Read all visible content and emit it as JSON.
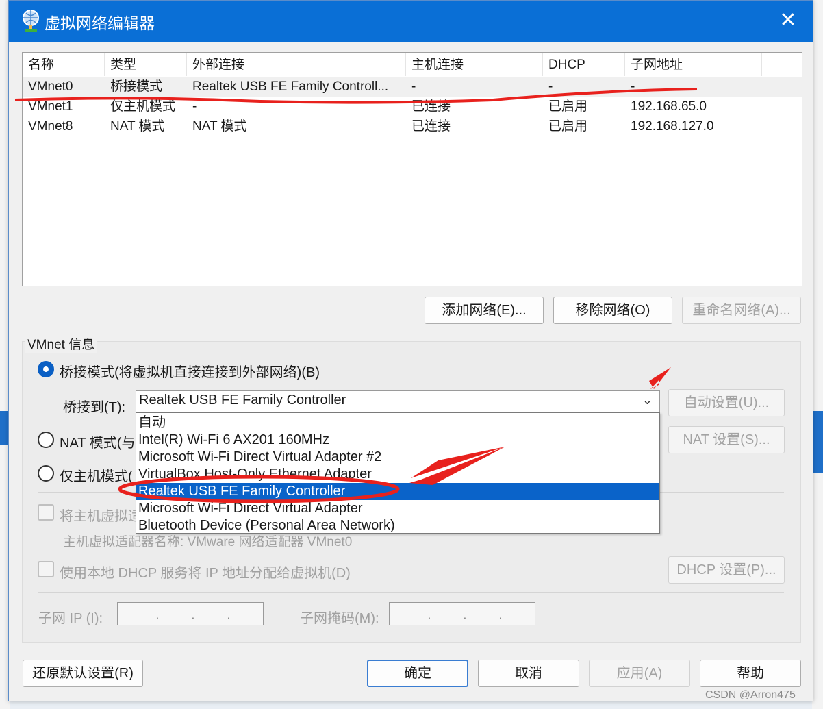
{
  "window": {
    "title": "虚拟网络编辑器",
    "close_glyph": "✕"
  },
  "list": {
    "columns": [
      "名称",
      "类型",
      "外部连接",
      "主机连接",
      "DHCP",
      "子网地址"
    ],
    "rows": [
      [
        "VMnet0",
        "桥接模式",
        "Realtek USB FE Family Controll...",
        "-",
        "-",
        "-"
      ],
      [
        "VMnet1",
        "仅主机模式",
        "-",
        "已连接",
        "已启用",
        "192.168.65.0"
      ],
      [
        "VMnet8",
        "NAT 模式",
        "NAT 模式",
        "已连接",
        "已启用",
        "192.168.127.0"
      ]
    ],
    "selected_row": 0
  },
  "list_buttons": {
    "add": "添加网络(E)...",
    "remove": "移除网络(O)",
    "rename": "重命名网络(A)..."
  },
  "vmnet_info": {
    "group_label": "VMnet 信息",
    "bridged_radio": "桥接模式(将虚拟机直接连接到外部网络)(B)",
    "bridge_to_label": "桥接到(T):",
    "bridge_to_value": "Realtek USB FE Family Controller",
    "bridge_options": [
      "自动",
      "Intel(R) Wi-Fi 6 AX201 160MHz",
      "Microsoft Wi-Fi Direct Virtual Adapter #2",
      "VirtualBox Host-Only Ethernet Adapter",
      "Realtek USB FE Family Controller",
      "Microsoft Wi-Fi Direct Virtual Adapter",
      "Bluetooth Device (Personal Area Network)"
    ],
    "highlighted_option": 4,
    "auto_settings": "自动设置(U)...",
    "nat_radio": "NAT 模式(与",
    "nat_settings": "NAT 设置(S)...",
    "hostonly_radio": "仅主机模式(",
    "host_adapter_check": "将主机虚拟适",
    "host_adapter_name": "主机虚拟适配器名称: VMware 网络适配器 VMnet0",
    "dhcp_check": "使用本地 DHCP 服务将 IP 地址分配给虚拟机(D)",
    "dhcp_settings": "DHCP 设置(P)...",
    "subnet_ip_label": "子网 IP (I):",
    "subnet_mask_label": "子网掩码(M):"
  },
  "footer": {
    "restore": "还原默认设置(R)",
    "ok": "确定",
    "cancel": "取消",
    "apply": "应用(A)",
    "help": "帮助"
  },
  "watermark": "CSDN @Arron475",
  "colors": {
    "titlebar": "#0a6fd6",
    "highlight": "#0a63c9",
    "annotation": "#e8211d"
  }
}
